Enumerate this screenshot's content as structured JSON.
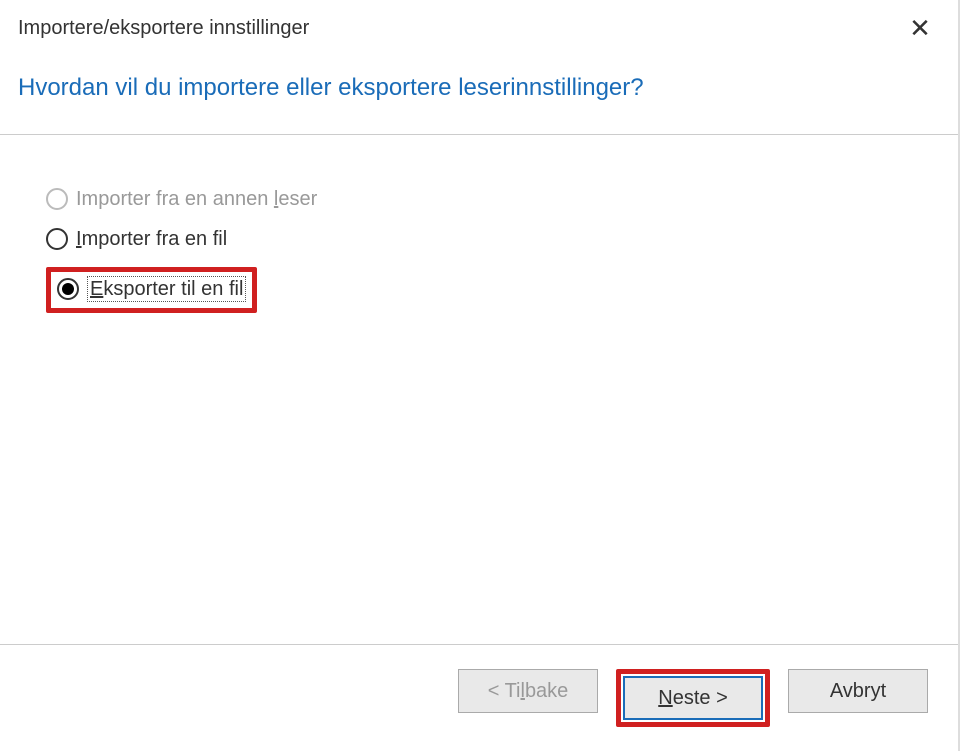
{
  "titlebar": {
    "title": "Importere/eksportere innstillinger"
  },
  "header": {
    "question": "Hvordan vil du importere eller eksportere leserinnstillinger?"
  },
  "options": {
    "opt1": {
      "pre": "Importer fra en annen ",
      "mnem": "l",
      "post": "eser",
      "enabled": false
    },
    "opt2": {
      "mnem": "I",
      "post": "mporter fra en fil",
      "enabled": true
    },
    "opt3": {
      "mnem": "E",
      "post": "ksporter til en fil",
      "enabled": true,
      "selected": true
    }
  },
  "footer": {
    "back_pre": "< Ti",
    "back_mnem": "l",
    "back_post": "bake",
    "next_mnem": "N",
    "next_post": "este >",
    "cancel": "Avbryt"
  }
}
